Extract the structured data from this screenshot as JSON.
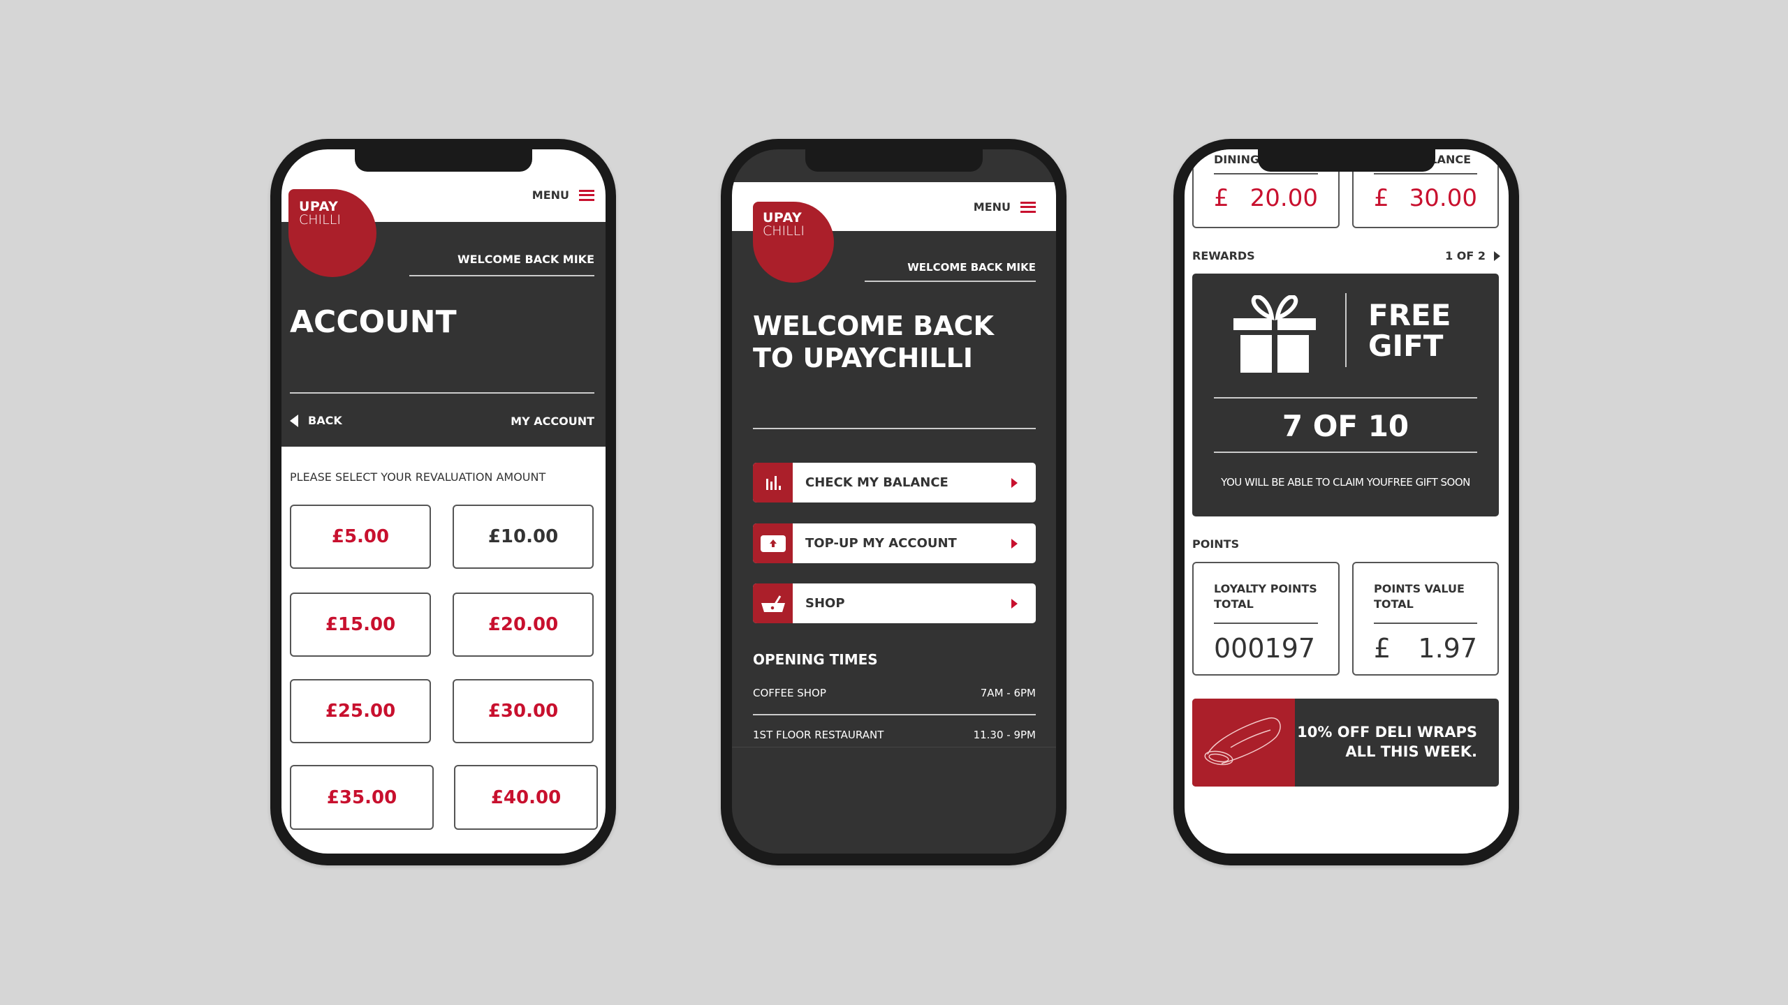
{
  "brand": {
    "logo_line1": "UPAY",
    "logo_line2": "CHILLI",
    "red": "#ab1f2a",
    "accent": "#c8102e",
    "dark": "#333333"
  },
  "header": {
    "menu_label": "MENU",
    "welcome": "WELCOME BACK MIKE"
  },
  "account": {
    "title": "ACCOUNT",
    "back_label": "BACK",
    "crumb": "MY ACCOUNT",
    "prompt": "PLEASE SELECT YOUR REVALUATION AMOUNT",
    "amounts": [
      "£5.00",
      "£10.00",
      "£15.00",
      "£20.00",
      "£25.00",
      "£30.00",
      "£35.00",
      "£40.00"
    ],
    "selected": "£10.00"
  },
  "home": {
    "title_line1": "WELCOME BACK",
    "title_line2": "TO UPAYCHILLI",
    "actions": [
      {
        "label": "CHECK MY BALANCE",
        "icon": "bar-chart-icon"
      },
      {
        "label": "TOP-UP MY ACCOUNT",
        "icon": "wallet-upload-icon"
      },
      {
        "label": "SHOP",
        "icon": "basket-icon"
      }
    ],
    "opening_title": "OPENING TIMES",
    "opening": [
      {
        "place": "COFFEE SHOP",
        "hours": "7AM - 6PM"
      },
      {
        "place": "1ST FLOOR RESTAURANT",
        "hours": "11.30 - 9PM"
      }
    ]
  },
  "rewards": {
    "balances": [
      {
        "label": "DINING",
        "currency": "£",
        "value": "20.00"
      },
      {
        "label": "BALANCE",
        "currency": "£",
        "value": "30.00"
      }
    ],
    "section": "REWARDS",
    "pager": "1 OF 2",
    "card_title_1": "FREE",
    "card_title_2": "GIFT",
    "progress": "7 OF 10",
    "progress_value": 7,
    "progress_total": 10,
    "message": "YOU WILL BE ABLE TO CLAIM YOUFREE GIFT SOON",
    "points_section": "POINTS",
    "points": [
      {
        "label1": "LOYALTY POINTS",
        "label2": "TOTAL",
        "currency": "",
        "value": "000197"
      },
      {
        "label1": "POINTS VALUE",
        "label2": "TOTAL",
        "currency": "£",
        "value": "1.97"
      }
    ],
    "promo_line1": "10% OFF DELI WRAPS",
    "promo_line2": "ALL THIS WEEK."
  }
}
